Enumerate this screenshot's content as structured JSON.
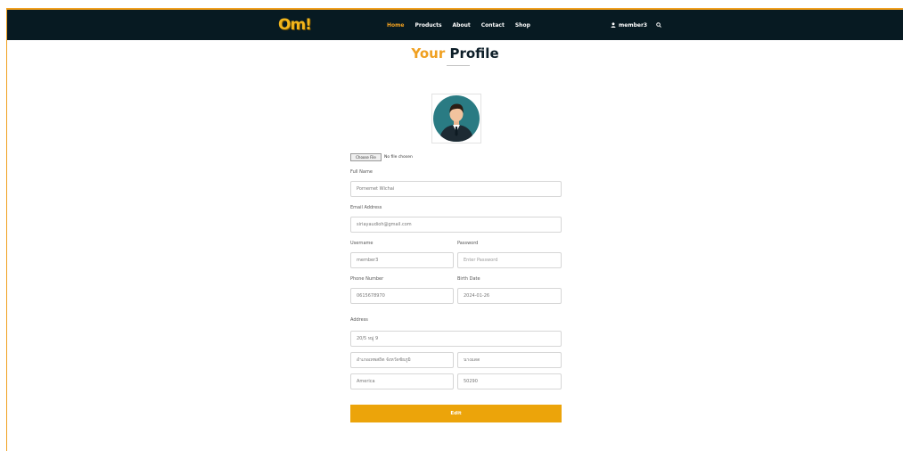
{
  "navbar": {
    "logo_text": "Om!",
    "links": [
      "Home",
      "Products",
      "About",
      "Contact",
      "Shop"
    ],
    "active_link": "Home",
    "username": "member3",
    "colors": {
      "background": "#071a22",
      "accent": "#f0a020"
    }
  },
  "page": {
    "title_part1": "Your",
    "title_part2": "Profile"
  },
  "file_input": {
    "button_label": "Choose File",
    "status": "No file chosen"
  },
  "form": {
    "full_name_label": "Full Name",
    "full_name_value": "Pornemet Wichai",
    "email_label": "Email Address",
    "email_value": "siriayaudioh@gmail.com",
    "username_label": "Username",
    "username_value": "member3",
    "password_label": "Password",
    "password_placeholder": "Enter Password",
    "phone_label": "Phone Number",
    "phone_value": "0615678970",
    "birth_label": "Birth Date",
    "birth_value": "2024-01-26",
    "address_label": "Address",
    "address_line1": "20/5 หมู่ 9",
    "district": "อำเภอเทพสถิต จังหวัดชัยภูมิ",
    "subdistrict": "นางแดด",
    "country": "America",
    "zip": "50290",
    "edit_label": "Edit"
  }
}
